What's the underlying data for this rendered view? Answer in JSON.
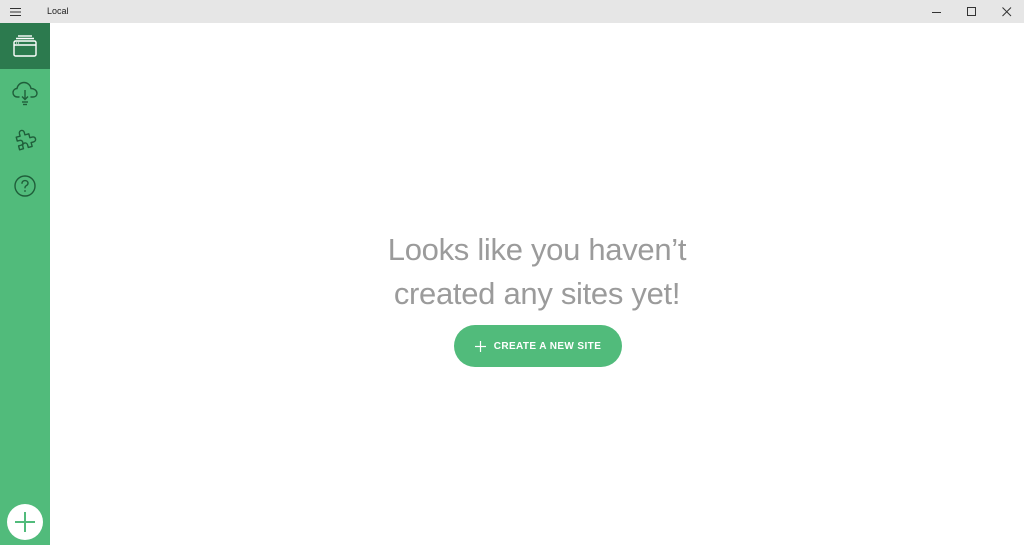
{
  "window": {
    "title": "Local",
    "titlebar_color": "#e6e6e6",
    "controls": [
      "minimize-icon",
      "maximize-icon",
      "close-icon"
    ]
  },
  "sidebar": {
    "background": "#51bb7b",
    "active_background": "#2c7a4e",
    "items": [
      {
        "id": "sites",
        "icon": "browser-window-icon",
        "active": true
      },
      {
        "id": "connect",
        "icon": "cloud-download-icon",
        "active": false
      },
      {
        "id": "addons",
        "icon": "puzzle-icon",
        "active": false
      },
      {
        "id": "help",
        "icon": "question-circle-icon",
        "active": false
      }
    ],
    "add_button_icon": "plus-icon"
  },
  "main": {
    "empty_state": {
      "line1": "Looks like you haven’t",
      "line2": "created any sites yet!"
    },
    "create_button": {
      "label": "CREATE A NEW SITE",
      "icon": "plus-icon",
      "color": "#51bb7b"
    }
  }
}
